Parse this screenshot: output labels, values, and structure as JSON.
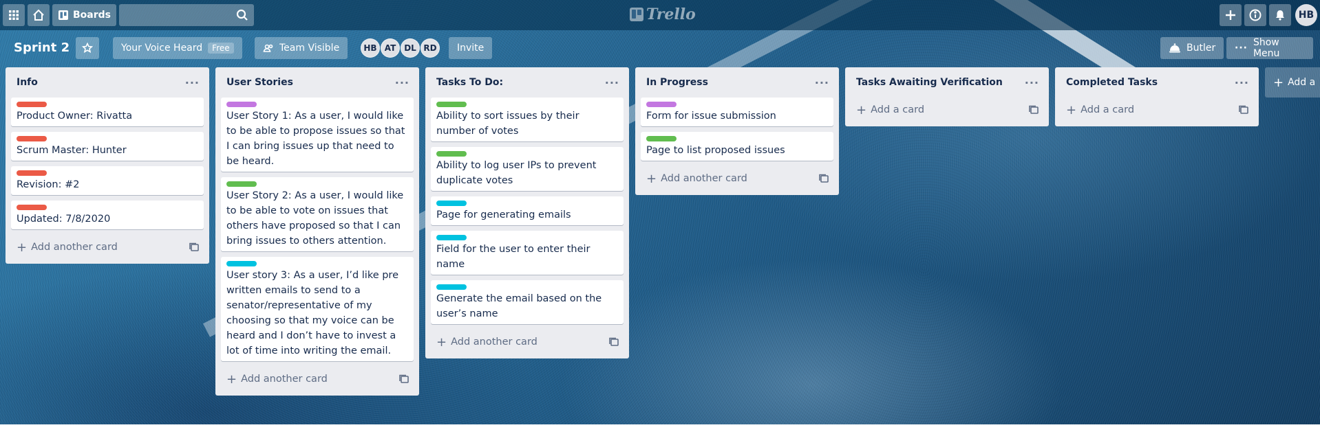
{
  "header": {
    "boards_label": "Boards",
    "logo_text": "Trello",
    "user_initials": "HB"
  },
  "board": {
    "title": "Sprint 2",
    "team_name": "Your Voice Heard",
    "team_plan": "Free",
    "visibility_label": "Team Visible",
    "members": [
      "HB",
      "AT",
      "DL",
      "RD"
    ],
    "invite_label": "Invite",
    "butler_label": "Butler",
    "show_menu_label": "Show Menu"
  },
  "colors": {
    "red": "#eb5a46",
    "green": "#61bd4f",
    "purple": "#c377e0",
    "sky": "#00c2e0"
  },
  "lists": [
    {
      "title": "Info",
      "cards": [
        {
          "label": "red",
          "text": "Product Owner: Rivatta"
        },
        {
          "label": "red",
          "text": "Scrum Master: Hunter"
        },
        {
          "label": "red",
          "text": "Revision: #2"
        },
        {
          "label": "red",
          "text": "Updated: 7/8/2020"
        }
      ],
      "add_label": "Add another card"
    },
    {
      "title": "User Stories",
      "cards": [
        {
          "label": "purple",
          "text": "User Story 1: As a user, I would like to be able to propose issues so that I can bring issues up that need to be heard."
        },
        {
          "label": "green",
          "text": "User Story 2: As a user, I would like to be able to vote on issues that others have proposed so that I can bring issues to others attention."
        },
        {
          "label": "sky",
          "text": "User story 3: As a user, I’d like pre written emails to send to a senator/representative of my choosing so that my voice can be heard and I don’t have to invest a lot of time into writing the email."
        }
      ],
      "add_label": "Add another card"
    },
    {
      "title": "Tasks To Do:",
      "cards": [
        {
          "label": "green",
          "text": "Ability to sort issues by their number of votes"
        },
        {
          "label": "green",
          "text": "Ability to log user IPs to prevent duplicate votes"
        },
        {
          "label": "sky",
          "text": "Page for generating emails"
        },
        {
          "label": "sky",
          "text": "Field for the user to enter their name"
        },
        {
          "label": "sky",
          "text": "Generate the email based on the user’s name"
        }
      ],
      "add_label": "Add another card"
    },
    {
      "title": "In Progress",
      "cards": [
        {
          "label": "purple",
          "text": "Form for issue submission"
        },
        {
          "label": "green",
          "text": "Page to list proposed issues"
        }
      ],
      "add_label": "Add another card"
    },
    {
      "title": "Tasks Awaiting Verification",
      "cards": [],
      "add_label": "Add a card"
    },
    {
      "title": "Completed Tasks",
      "cards": [],
      "add_label": "Add a card"
    }
  ],
  "add_list_label": "Add a"
}
